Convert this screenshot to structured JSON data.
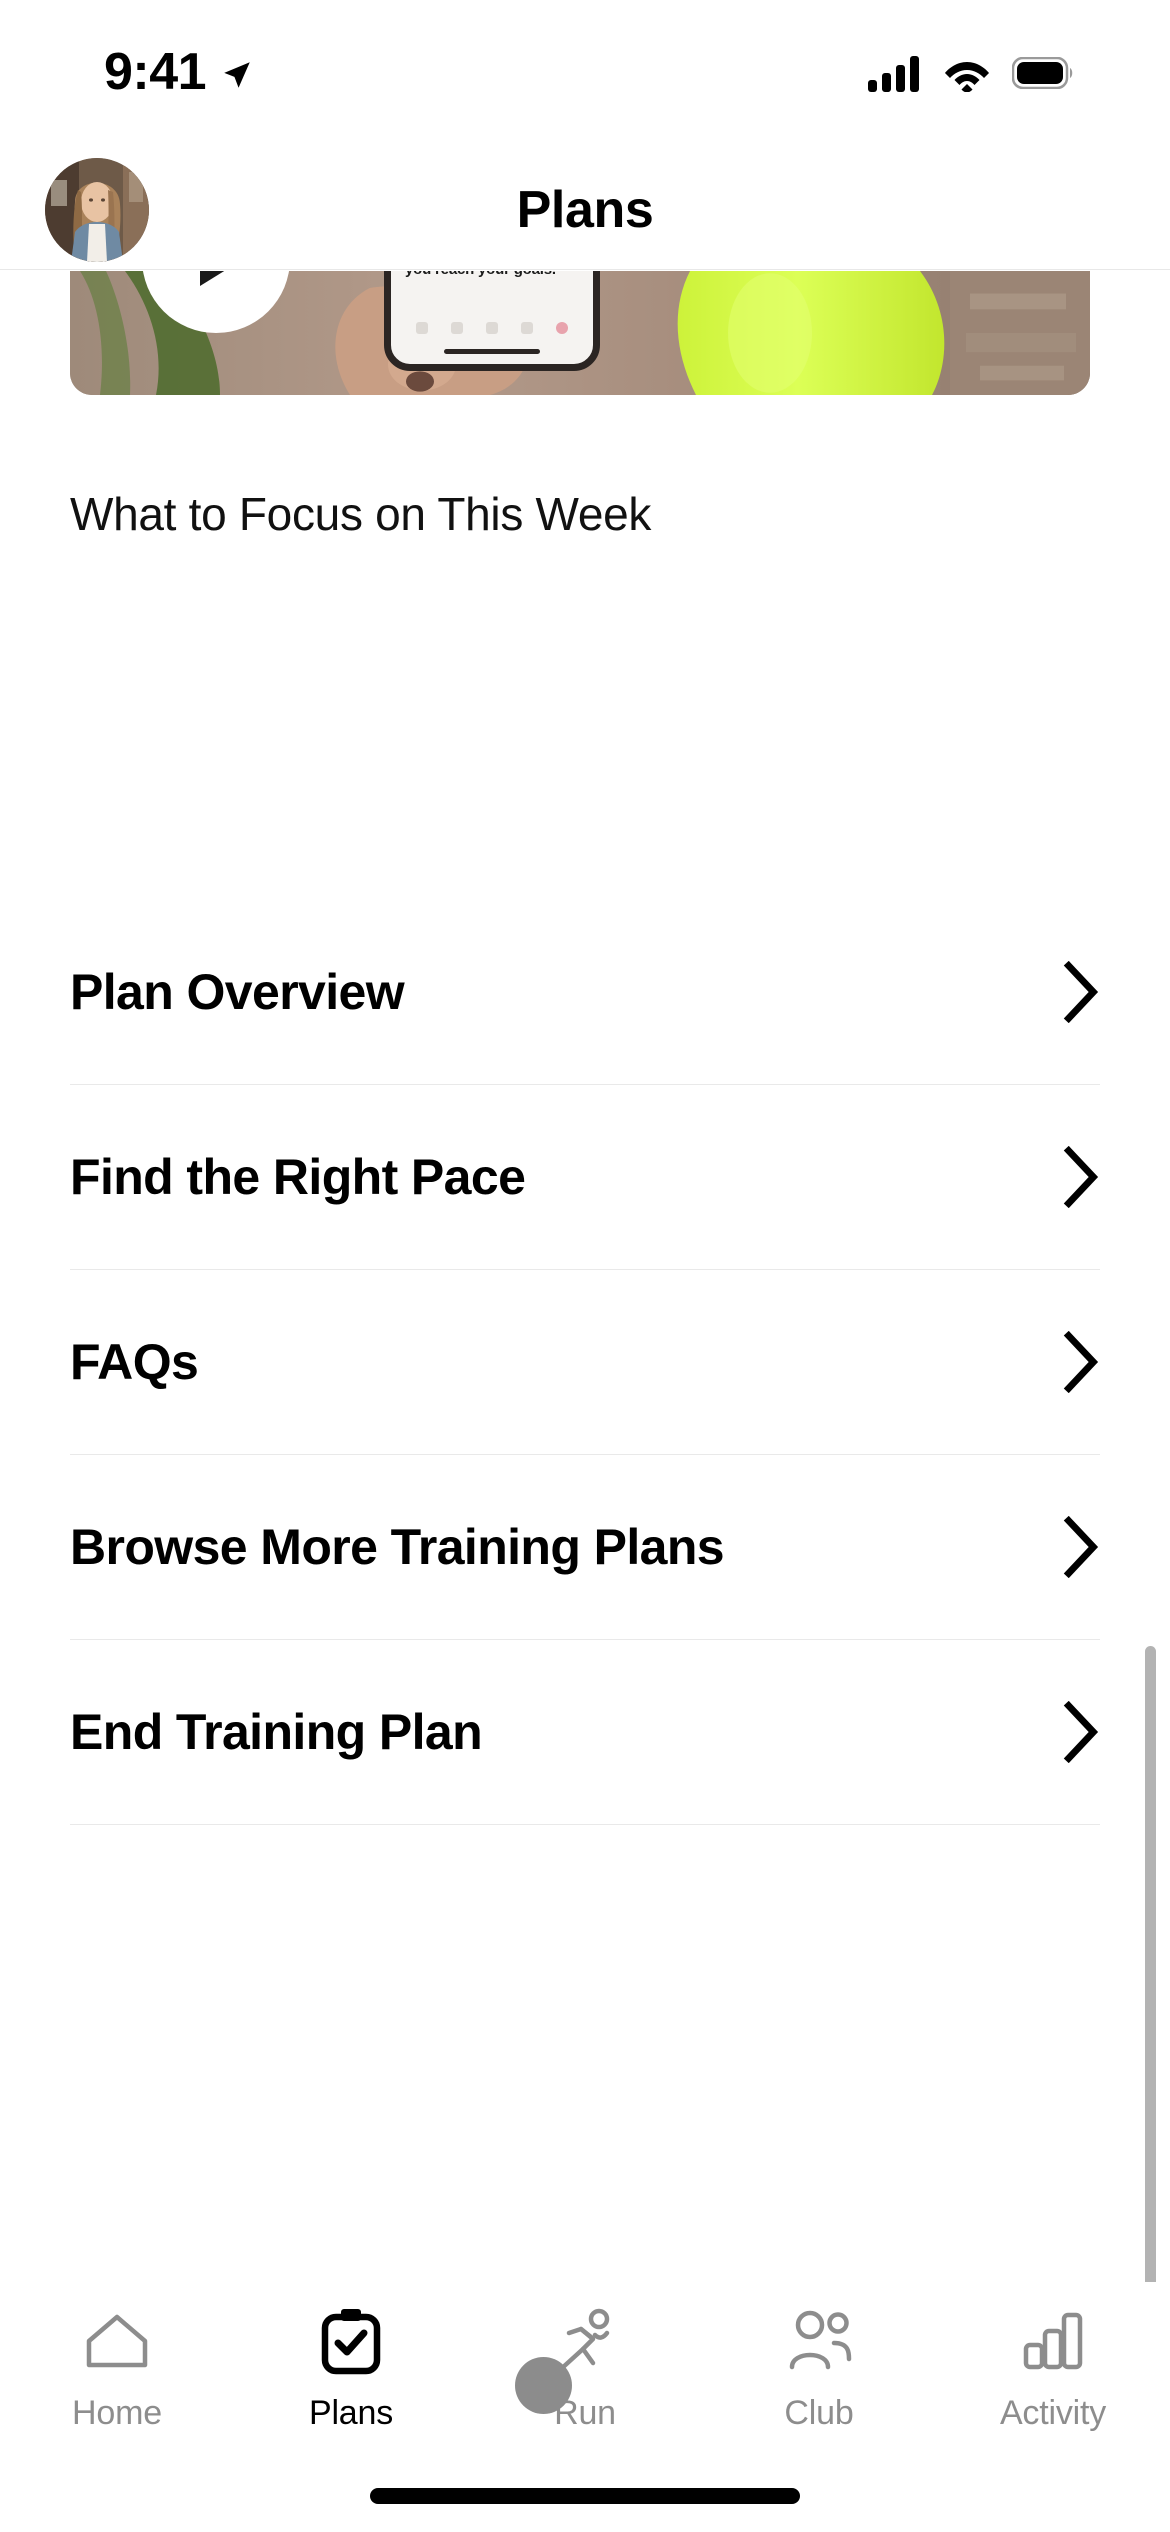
{
  "status_bar": {
    "time": "9:41",
    "location_icon": "location-arrow-icon",
    "cellular_icon": "cellular-signal-icon",
    "cellular_bars": 4,
    "wifi_icon": "wifi-icon",
    "battery_icon": "battery-full-icon"
  },
  "header": {
    "title": "Plans",
    "avatar_icon": "user-avatar-photo"
  },
  "hero": {
    "type": "video-card",
    "play_icon": "play-button-icon",
    "phone_copy": "Nike training plans give you weekly coaching and guidance to help you reach your goals."
  },
  "section": {
    "heading": "What to Focus on This Week"
  },
  "menu": {
    "chevron_icon": "chevron-right-icon",
    "items": [
      {
        "label": "Plan Overview"
      },
      {
        "label": "Find the Right Pace"
      },
      {
        "label": "FAQs"
      },
      {
        "label": "Browse More Training Plans"
      },
      {
        "label": "End Training Plan"
      }
    ]
  },
  "tabbar": {
    "tabs": [
      {
        "label": "Home",
        "icon": "home-icon",
        "active": false
      },
      {
        "label": "Plans",
        "icon": "clipboard-check-icon",
        "active": true
      },
      {
        "label": "Run",
        "icon": "running-person-icon",
        "active": false
      },
      {
        "label": "Club",
        "icon": "people-icon",
        "active": false
      },
      {
        "label": "Activity",
        "icon": "bar-chart-icon",
        "active": false
      }
    ]
  },
  "colors": {
    "active": "#000000",
    "inactive": "#8d8d8d",
    "divider": "#e9e9e9",
    "scrollbar": "#b3b3b3",
    "cursor": "#8c8c8c",
    "accent_green": "#d7ff3e"
  }
}
